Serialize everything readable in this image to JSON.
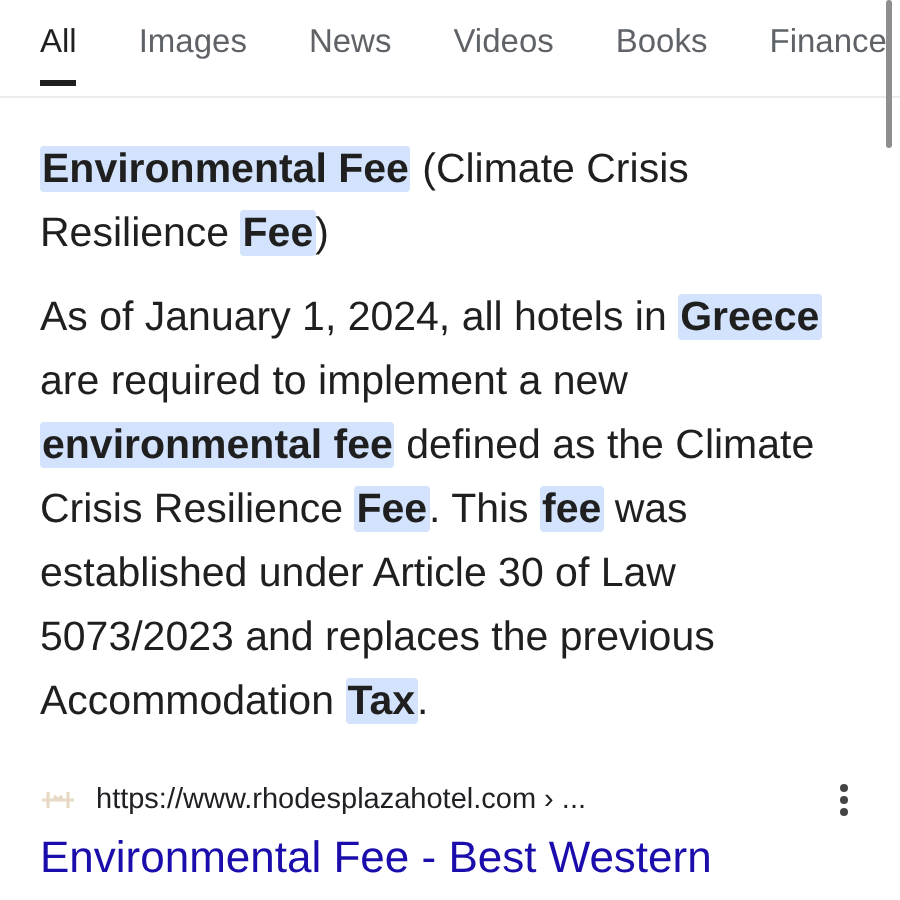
{
  "tabs": [
    {
      "label": "All",
      "selected": true
    },
    {
      "label": "Images",
      "selected": false
    },
    {
      "label": "News",
      "selected": false
    },
    {
      "label": "Videos",
      "selected": false
    },
    {
      "label": "Books",
      "selected": false
    },
    {
      "label": "Finance",
      "selected": false
    }
  ],
  "heading": [
    {
      "text": "Environmental Fee",
      "highlighted": true
    },
    {
      "text": " (Climate Crisis Resilience ",
      "highlighted": false
    },
    {
      "text": "Fee",
      "highlighted": true
    },
    {
      "text": ")",
      "highlighted": false
    }
  ],
  "snippet": [
    {
      "text": "As of January 1, 2024, all hotels in ",
      "highlighted": false
    },
    {
      "text": "Greece",
      "highlighted": true
    },
    {
      "text": " are required to implement a new ",
      "highlighted": false
    },
    {
      "text": "environmental fee",
      "highlighted": true
    },
    {
      "text": " defined as the Climate Crisis Resilience ",
      "highlighted": false
    },
    {
      "text": "Fee",
      "highlighted": true
    },
    {
      "text": ". This ",
      "highlighted": false
    },
    {
      "text": "fee",
      "highlighted": true
    },
    {
      "text": " was established under Article 30 of Law 5073/2023 and replaces the previous Accommodation ",
      "highlighted": false
    },
    {
      "text": "Tax",
      "highlighted": true
    },
    {
      "text": ".",
      "highlighted": false
    }
  ],
  "result": {
    "url": "https://www.rhodesplazahotel.com › ...",
    "title": "Environmental Fee - Best Western"
  }
}
